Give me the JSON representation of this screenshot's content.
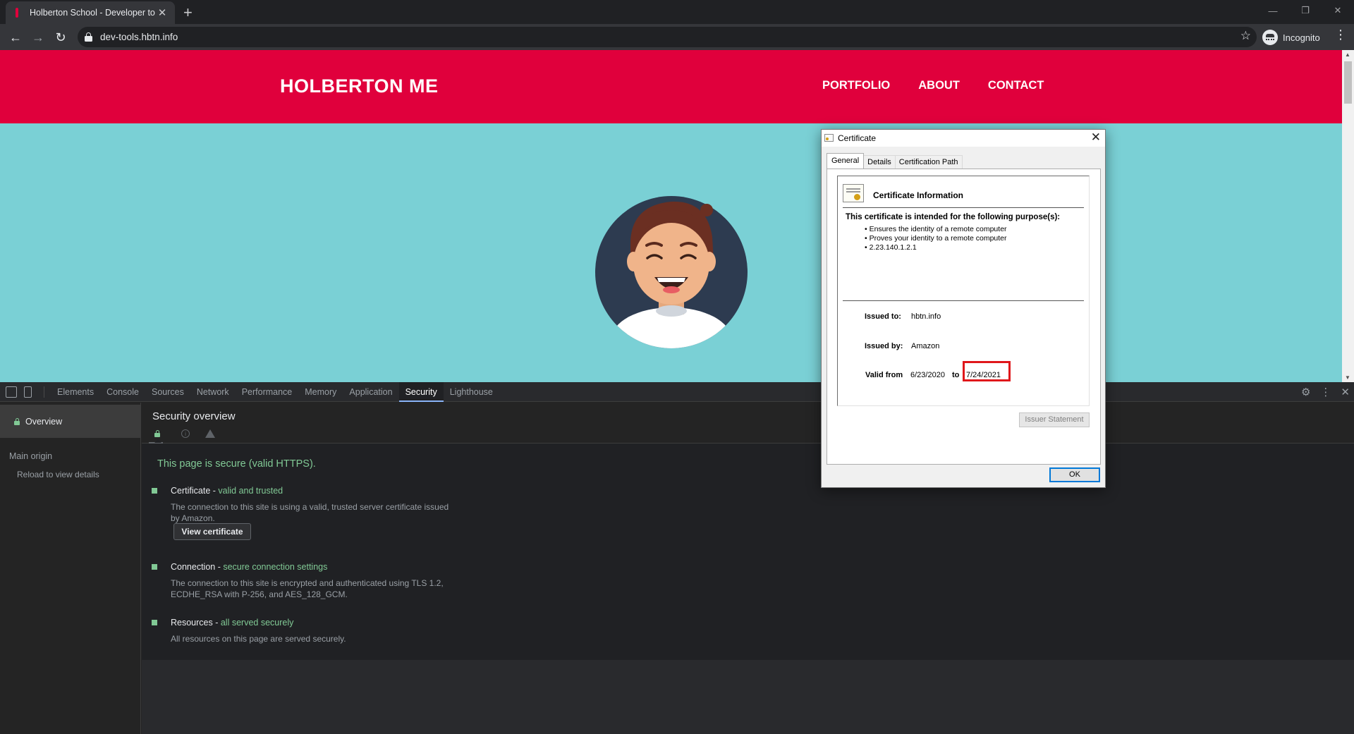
{
  "browser": {
    "tab_title": "Holberton School - Developer to",
    "url": "dev-tools.hbtn.info",
    "profile_label": "Incognito"
  },
  "site": {
    "logo": "HOLBERTON ME",
    "nav": [
      "PORTFOLIO",
      "ABOUT",
      "CONTACT"
    ],
    "colors": {
      "header": "#e0003c",
      "body": "#7ad0d5"
    }
  },
  "devtools": {
    "tabs": [
      "Elements",
      "Console",
      "Sources",
      "Network",
      "Performance",
      "Memory",
      "Application",
      "Security",
      "Lighthouse"
    ],
    "active_tab": "Security",
    "sidebar": {
      "overview": "Overview",
      "main_origin": "Main origin",
      "reload": "Reload to view details"
    },
    "security": {
      "title": "Security overview",
      "secure_message": "This page is secure (valid HTTPS).",
      "items": [
        {
          "key": "Certificate",
          "value": "valid and trusted",
          "description": "The connection to this site is using a valid, trusted server certificate issued by Amazon.",
          "button": "View certificate"
        },
        {
          "key": "Connection",
          "value": "secure connection settings",
          "description": "The connection to this site is encrypted and authenticated using TLS 1.2, ECDHE_RSA with P-256, and AES_128_GCM."
        },
        {
          "key": "Resources",
          "value": "all served securely",
          "description": "All resources on this page are served securely."
        }
      ]
    }
  },
  "certificate": {
    "window_title": "Certificate",
    "tabs": [
      "General",
      "Details",
      "Certification Path"
    ],
    "active_tab": "General",
    "info_title": "Certificate Information",
    "purpose_heading": "This certificate is intended for the following purpose(s):",
    "purposes": [
      "• Ensures the identity of a remote computer",
      "• Proves your identity to a remote computer",
      "• 2.23.140.1.2.1"
    ],
    "issued_to_label": "Issued to:",
    "issued_to": "hbtn.info",
    "issued_by_label": "Issued by:",
    "issued_by": "Amazon",
    "valid_from_label": "Valid from",
    "valid_from": "6/23/2020",
    "to_label": "to",
    "valid_to": "7/24/2021",
    "issuer_statement": "Issuer Statement",
    "ok": "OK"
  }
}
